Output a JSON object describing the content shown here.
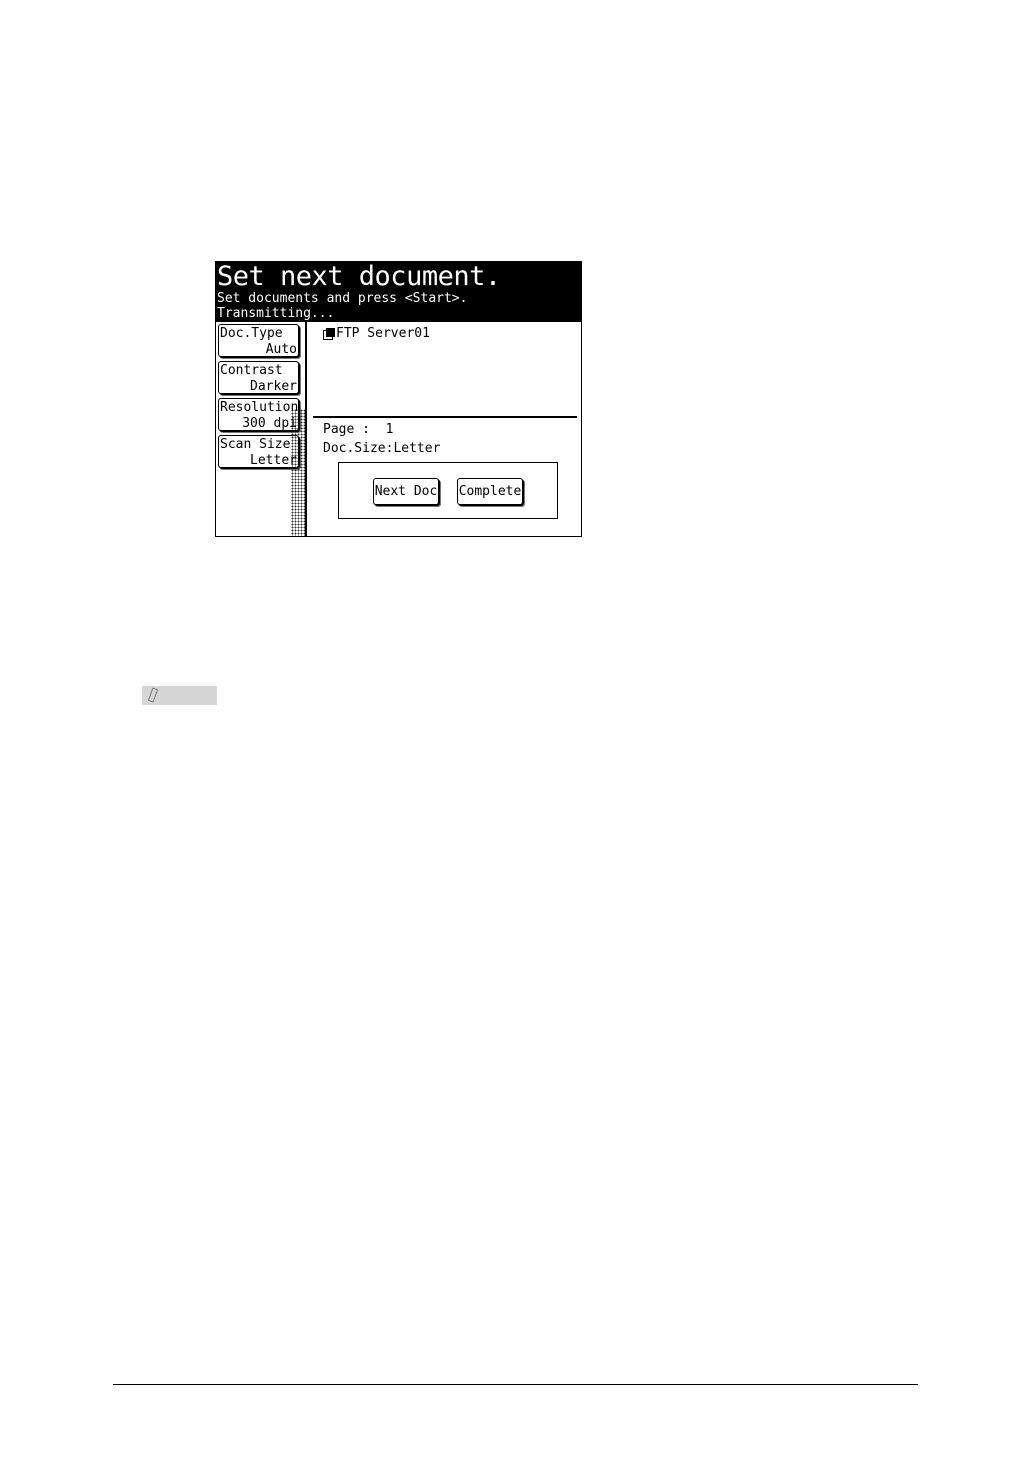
{
  "screen": {
    "title": "Set next document.",
    "message_line1": "Set documents and press <Start>.",
    "message_line2": "Transmitting..."
  },
  "sidebar": {
    "items": [
      {
        "label": "Doc.Type",
        "value": "Auto"
      },
      {
        "label": "Contrast",
        "value": "Darker"
      },
      {
        "label": "Resolution",
        "value": "300 dpi"
      },
      {
        "label": "Scan Size",
        "value": "Letter"
      }
    ]
  },
  "main": {
    "destination": "FTP Server01",
    "destination_icon": "ftp-server-icon",
    "page_line": "Page :  1",
    "doc_size_line": "Doc.Size:Letter"
  },
  "actions": {
    "next_doc": "Next Doc",
    "complete": "Complete"
  },
  "note": {
    "icon": "pencil-icon"
  }
}
